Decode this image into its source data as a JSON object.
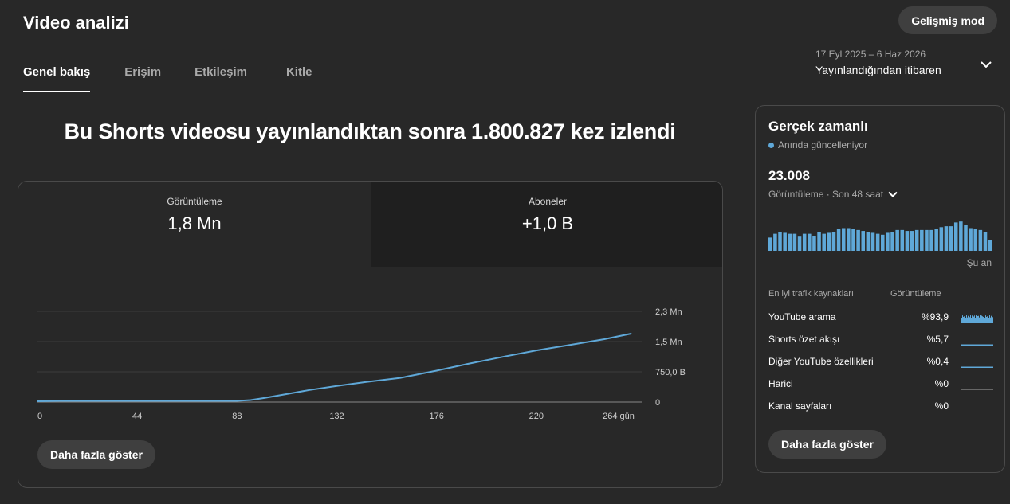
{
  "header": {
    "title": "Video analizi",
    "advanced_mode": "Gelişmiş mod",
    "tabs": [
      "Genel bakış",
      "Erişim",
      "Etkileşim",
      "Kitle"
    ],
    "active_tab": 0,
    "date_range": "17 Eyl 2025 – 6 Haz 2026",
    "date_label": "Yayınlandığından itibaren"
  },
  "headline": "Bu Shorts videosu yayınlandıktan sonra 1.800.827 kez izlendi",
  "metrics": [
    {
      "label": "Görüntüleme",
      "value": "1,8 Mn"
    },
    {
      "label": "Aboneler",
      "value": "+1,0 B"
    }
  ],
  "show_more": "Daha fazla göster",
  "chart_data": {
    "type": "line",
    "x_ticks": [
      "0",
      "44",
      "88",
      "132",
      "176",
      "220",
      "264 gün"
    ],
    "y_ticks": [
      "0",
      "750,0 B",
      "1,5 Mn",
      "2,3 Mn"
    ],
    "xlim": [
      0,
      264
    ],
    "ylim": [
      0,
      2250000
    ],
    "grid": true,
    "series": [
      {
        "color": "#5fa8d8",
        "x": [
          0,
          10,
          44,
          80,
          88,
          94,
          100,
          110,
          120,
          132,
          145,
          160,
          176,
          190,
          205,
          220,
          235,
          250,
          262
        ],
        "y": [
          20000,
          30000,
          30000,
          30000,
          30000,
          50000,
          100000,
          200000,
          300000,
          400000,
          500000,
          600000,
          780000,
          950000,
          1120000,
          1280000,
          1420000,
          1560000,
          1700000
        ]
      }
    ]
  },
  "realtime": {
    "title": "Gerçek zamanlı",
    "live_label": "Anında güncelleniyor",
    "count": "23.008",
    "sub_label": "Görüntüleme · Son 48 saat",
    "now_label": "Şu an",
    "bars": [
      14,
      18,
      20,
      19,
      18,
      18,
      15,
      18,
      18,
      16,
      20,
      18,
      19,
      20,
      23,
      24,
      24,
      23,
      22,
      21,
      20,
      19,
      18,
      17,
      19,
      20,
      22,
      22,
      21,
      21,
      22,
      22,
      22,
      22,
      23,
      25,
      26,
      26,
      30,
      31,
      27,
      24,
      23,
      22,
      20,
      11
    ],
    "sources_header": {
      "name": "En iyi trafik kaynakları",
      "views": "Görüntüleme"
    },
    "sources": [
      {
        "name": "YouTube arama",
        "pct": "%93,9"
      },
      {
        "name": "Shorts özet akışı",
        "pct": "%5,7"
      },
      {
        "name": "Diğer YouTube özellikleri",
        "pct": "%0,4"
      },
      {
        "name": "Harici",
        "pct": "%0"
      },
      {
        "name": "Kanal sayfaları",
        "pct": "%0"
      }
    ],
    "show_more": "Daha fazla göster"
  }
}
